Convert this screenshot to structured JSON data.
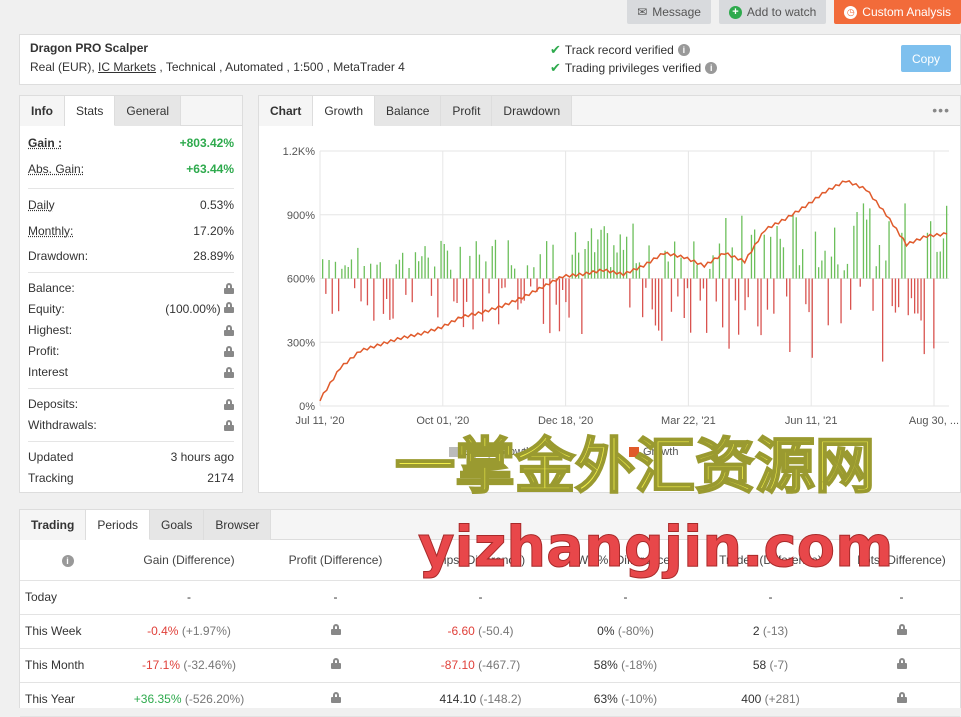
{
  "top_buttons": {
    "message": "Message",
    "watch": "Add to watch",
    "analysis": "Custom Analysis"
  },
  "system": {
    "name": "Dragon PRO Scalper",
    "meta_prefix": "Real (EUR), ",
    "broker": "IC Markets",
    "meta_suffix": " , Technical , Automated , 1:500 , MetaTrader 4",
    "verify1": "Track record verified",
    "verify2": "Trading privileges verified",
    "copy": "Copy"
  },
  "left_tabs": [
    "Info",
    "Stats",
    "General"
  ],
  "stats": {
    "gain_label": "Gain :",
    "gain": "+803.42%",
    "abs_label": "Abs. Gain:",
    "abs": "+63.44%",
    "daily_label": "Daily",
    "daily": "0.53%",
    "monthly_label": "Monthly:",
    "monthly": "17.20%",
    "drawdown_label": "Drawdown:",
    "drawdown": "28.89%",
    "balance_label": "Balance:",
    "equity_label": "Equity:",
    "equity": "(100.00%)",
    "highest_label": "Highest:",
    "profit_label": "Profit:",
    "interest_label": "Interest",
    "deposits_label": "Deposits:",
    "withdrawals_label": "Withdrawals:",
    "updated_label": "Updated",
    "updated": "3 hours ago",
    "tracking_label": "Tracking",
    "tracking": "2174"
  },
  "chart_tabs": [
    "Chart",
    "Growth",
    "Balance",
    "Profit",
    "Drawdown"
  ],
  "chart_data": {
    "type": "line",
    "y_ticks": [
      "0%",
      "300%",
      "600%",
      "900%",
      "1.2K%"
    ],
    "x_ticks": [
      "Jul 11, '20",
      "Oct 01, '20",
      "Dec 18, '20",
      "Mar 22, '21",
      "Jun 11, '21",
      "Aug 30, ..."
    ],
    "ylim": [
      0,
      1200
    ],
    "legend": [
      "Equity Growth",
      "Growth"
    ],
    "series": [
      {
        "name": "Growth",
        "color": "#e05a2b",
        "x": [
          "Jul 11, '20",
          "Jul 14, '20",
          "Jul 18, '20",
          "Jul 22, '20",
          "Aug 01, '20",
          "Aug 20, '20",
          "Sep 10, '20",
          "Oct 01, '20",
          "Oct 20, '20",
          "Nov 10, '20",
          "Dec 01, '20",
          "Dec 18, '20",
          "Jan 10, '21",
          "Feb 01, '21",
          "Feb 20, '21",
          "Mar 05, '21",
          "Mar 22, '21",
          "Apr 10, '21",
          "Apr 25, '21",
          "May 10, '21",
          "May 25, '21",
          "Jun 11, '21",
          "Jun 25, '21",
          "Jul 05, '21",
          "Jul 15, '21",
          "Jul 25, '21",
          "Aug 01, '21",
          "Aug 10, '21",
          "Aug 18, '21",
          "Aug 25, '21",
          "Aug 30, '21",
          "Sep 05, '21"
        ],
        "y": [
          30,
          180,
          260,
          290,
          320,
          340,
          370,
          420,
          440,
          470,
          510,
          560,
          610,
          620,
          640,
          620,
          660,
          720,
          700,
          660,
          720,
          680,
          830,
          880,
          940,
          1010,
          1060,
          1020,
          900,
          760,
          800,
          810
        ]
      }
    ],
    "bars_note": "Growth difference bars"
  },
  "bottom_tabs": [
    "Trading",
    "Periods",
    "Goals",
    "Browser"
  ],
  "periods": {
    "headers": [
      "Gain (Difference)",
      "Profit (Difference)",
      "Pips (Difference)",
      "Win% (Difference)",
      "Trades (Difference)",
      "Lots (Difference)"
    ],
    "rows": [
      {
        "label": "Today",
        "gain": "-",
        "gain_diff": "",
        "profit": "-",
        "pips": "-",
        "pips_diff": "",
        "win": "-",
        "win_diff": "",
        "trades": "-",
        "trades_diff": "",
        "lots": "-"
      },
      {
        "label": "This Week",
        "gain": "-0.4%",
        "gain_diff": "(+1.97%)",
        "profit": "lock",
        "pips": "-6.60",
        "pips_diff": "(-50.4)",
        "win": "0%",
        "win_diff": "(-80%)",
        "trades": "2",
        "trades_diff": "(-13)",
        "lots": "lock"
      },
      {
        "label": "This Month",
        "gain": "-17.1%",
        "gain_diff": "(-32.46%)",
        "profit": "lock",
        "pips": "-87.10",
        "pips_diff": "(-467.7)",
        "win": "58%",
        "win_diff": "(-18%)",
        "trades": "58",
        "trades_diff": "(-7)",
        "lots": "lock"
      },
      {
        "label": "This Year",
        "gain": "+36.35%",
        "gain_diff": "(-526.20%)",
        "profit": "lock",
        "pips": "414.10",
        "pips_diff": "(-148.2)",
        "win": "63%",
        "win_diff": "(-10%)",
        "trades": "400",
        "trades_diff": "(+281)",
        "lots": "lock"
      }
    ]
  },
  "watermark": {
    "line1": "一掌金外汇资源网",
    "line2": "yizhangjin.com"
  }
}
